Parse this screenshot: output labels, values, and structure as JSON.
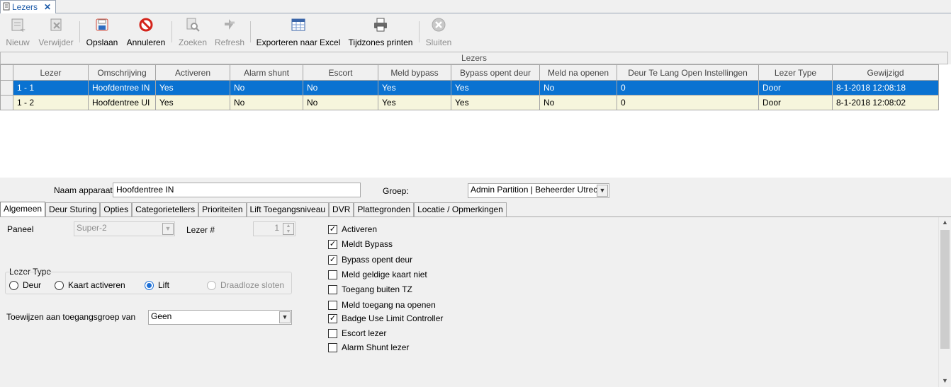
{
  "tab": {
    "title": "Lezers",
    "close": "✕"
  },
  "toolbar": {
    "nieuw": "Nieuw",
    "verwijder": "Verwijder",
    "opslaan": "Opslaan",
    "annuleren": "Annuleren",
    "zoeken": "Zoeken",
    "refresh": "Refresh",
    "exporteren": "Exporteren naar Excel",
    "tijdzones": "Tijdzones printen",
    "sluiten": "Sluiten"
  },
  "grid": {
    "caption": "Lezers",
    "columns": [
      "Lezer",
      "Omschrijving",
      "Activeren",
      "Alarm shunt",
      "Escort",
      "Meld bypass",
      "Bypass opent deur",
      "Meld na openen",
      "Deur Te Lang Open Instellingen",
      "Lezer Type",
      "Gewijzigd"
    ],
    "rows": [
      [
        "1 - 1",
        "Hoofdentree IN",
        "Yes",
        "No",
        "No",
        "Yes",
        "Yes",
        "No",
        "0",
        "Door",
        "8-1-2018 12:08:18"
      ],
      [
        "1 - 2",
        "Hoofdentree UI",
        "Yes",
        "No",
        "No",
        "Yes",
        "Yes",
        "No",
        "0",
        "Door",
        "8-1-2018 12:08:02"
      ]
    ]
  },
  "form": {
    "naam_label": "Naam apparaat",
    "naam_value": "Hoofdentree IN",
    "groep_label": "Groep:",
    "groep_value": "Admin Partition | Beheerder Utrech"
  },
  "tabs": [
    "Algemeen",
    "Deur Sturing",
    "Opties",
    "Categorietellers",
    "Prioriteiten",
    "Lift Toegangsniveau",
    "DVR",
    "Plattegronden",
    "Locatie / Opmerkingen"
  ],
  "algemeen": {
    "paneel_label": "Paneel",
    "paneel_value": "Super-2",
    "lezer_num_label": "Lezer #",
    "lezer_num_value": "1",
    "lezer_type_label": "Lezer Type",
    "radios": {
      "deur": "Deur",
      "kaart": "Kaart activeren",
      "lift": "Lift",
      "draadloze": "Draadloze sloten"
    },
    "toewijzen_label": "Toewijzen aan toegangsgroep van",
    "toewijzen_value": "Geen",
    "checkboxes": [
      {
        "label": "Activeren",
        "checked": true
      },
      {
        "label": "Meldt Bypass",
        "checked": true
      },
      {
        "label": "Bypass opent deur",
        "checked": true
      },
      {
        "label": "Meld geldige kaart niet",
        "checked": false
      },
      {
        "label": "Toegang buiten TZ",
        "checked": false
      },
      {
        "label": "Meld toegang na openen",
        "checked": false
      },
      {
        "label": "Badge Use Limit Controller",
        "checked": true
      },
      {
        "label": "Escort lezer",
        "checked": false
      },
      {
        "label": "Alarm Shunt lezer",
        "checked": false
      }
    ]
  }
}
